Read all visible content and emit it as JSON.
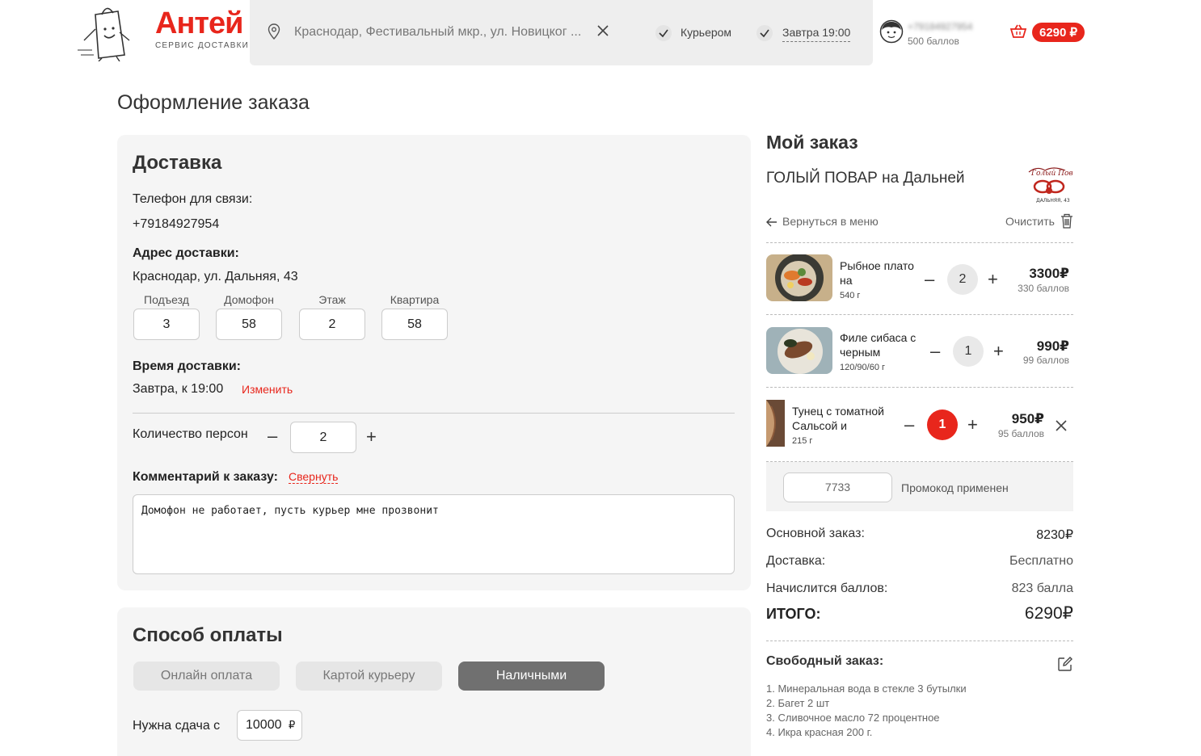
{
  "header": {
    "logo_title": "Антей",
    "logo_subtitle": "СЕРВИС ДОСТАВКИ",
    "address": "Краснодар, Фестивальный мкр., ул. Новицког ...",
    "courier_label": "Курьером",
    "time_label": "Завтра 19:00",
    "user_phone": "+79184927954",
    "user_points": "500 баллов",
    "cart_total": "6290 ₽"
  },
  "page_title": "Оформление заказа",
  "delivery": {
    "title": "Доставка",
    "phone_label": "Телефон для связи:",
    "phone_value": "+79184927954",
    "address_label": "Адрес доставки:",
    "address_value": "Краснодар, ул. Дальняя, 43",
    "fields": [
      {
        "label": "Подъезд",
        "value": "3"
      },
      {
        "label": "Домофон",
        "value": "58"
      },
      {
        "label": "Этаж",
        "value": "2"
      },
      {
        "label": "Квартира",
        "value": "58"
      }
    ],
    "time_label": "Время доставки:",
    "time_value": "Завтра, к 19:00",
    "change_link": "Изменить",
    "persons_label": "Количество персон",
    "persons_minus": "–",
    "persons_value": "2",
    "persons_plus": "+",
    "comment_label": "Комментарий к заказу:",
    "collapse_link": "Свернуть",
    "comment_value": "Домофон не работает, пусть курьер мне прозвонит"
  },
  "payment": {
    "title": "Способ оплаты",
    "options": [
      "Онлайн оплата",
      "Картой курьеру",
      "Наличными"
    ],
    "selected": "Наличными",
    "change_label": "Нужна сдача с",
    "change_value": "10000",
    "currency": "₽"
  },
  "order": {
    "title": "Мой заказ",
    "restaurant": "ГОЛЫЙ ПОВАР на Дальней",
    "back_link": "Вернуться в меню",
    "clear_link": "Очистить",
    "items": [
      {
        "name": "Рыбное плато на",
        "weight": "540 г",
        "qty": "2",
        "price": "3300",
        "points": "330 баллов"
      },
      {
        "name": "Филе сибаса с черным",
        "weight": "120/90/60 г",
        "qty": "1",
        "price": "990",
        "points": "99 баллов"
      },
      {
        "name": "Тунец с томатной Сальсой и",
        "weight": "215 г",
        "qty": "1",
        "price": "950",
        "points": "95 баллов"
      }
    ],
    "minus": "–",
    "plus": "+",
    "currency": "₽",
    "promo_code": "7733",
    "promo_status": "Промокод применен",
    "subtotal_label": "Основной заказ:",
    "subtotal_value": "8230",
    "delivery_label": "Доставка:",
    "delivery_value": "Бесплатно",
    "points_label": "Начислится баллов:",
    "points_value": "823 балла",
    "total_label": "ИТОГО:",
    "total_value": "6290",
    "free_order_title": "Свободный заказ:",
    "free_order_items": [
      "1. Минеральная вода в стекле 3 бутылки",
      "2. Багет 2 шт",
      "3. Сливочное масло 72 процентное",
      "4. Икра красная 200 г."
    ]
  },
  "colors": {
    "accent": "#e8261c",
    "card_bg": "#f5f5f5",
    "active_btn": "#707070"
  }
}
